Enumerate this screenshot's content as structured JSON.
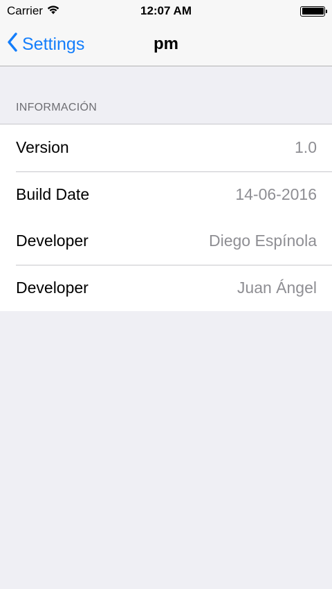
{
  "status_bar": {
    "carrier": "Carrier",
    "time": "12:07 AM",
    "battery_level": 1.0
  },
  "nav": {
    "back_label": "Settings",
    "title": "pm"
  },
  "section": {
    "header": "INFORMACIÓN",
    "rows": [
      {
        "label": "Version",
        "value": "1.0"
      },
      {
        "label": "Build Date",
        "value": "14-06-2016"
      },
      {
        "label": "Developer",
        "value": "Diego Espínola"
      },
      {
        "label": "Developer",
        "value": "Juan Ángel"
      }
    ]
  },
  "colors": {
    "accent": "#147efb",
    "background": "#efeff4",
    "secondary_text": "#8e8e93"
  },
  "icons": {
    "wifi": "wifi-icon",
    "battery": "battery-icon",
    "back": "chevron-left-icon"
  }
}
